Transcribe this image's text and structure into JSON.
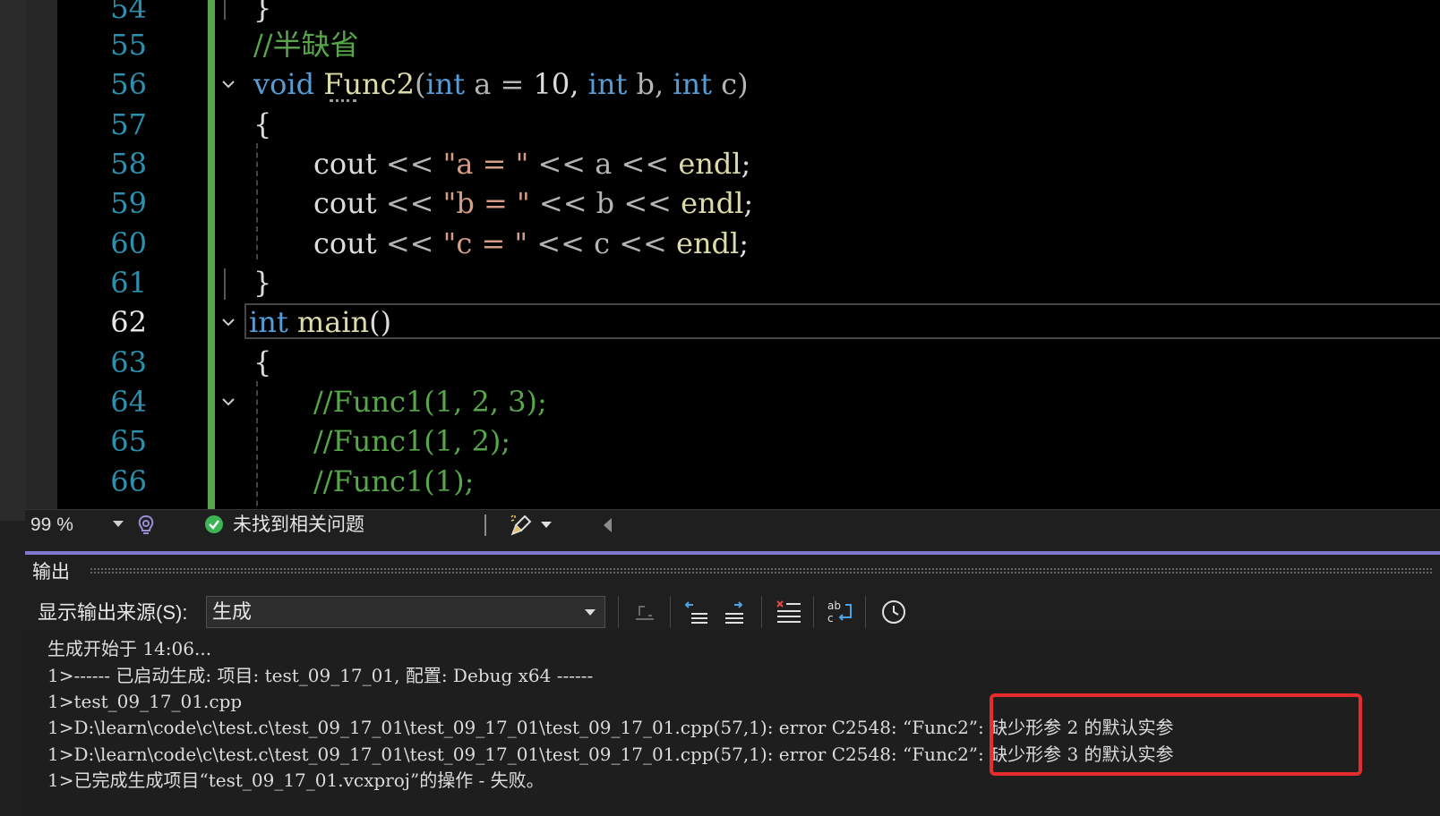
{
  "editor": {
    "lines": [
      {
        "num": "54"
      },
      {
        "num": "55"
      },
      {
        "num": "56"
      },
      {
        "num": "57"
      },
      {
        "num": "58"
      },
      {
        "num": "59"
      },
      {
        "num": "60"
      },
      {
        "num": "61"
      },
      {
        "num": "62"
      },
      {
        "num": "63"
      },
      {
        "num": "64"
      },
      {
        "num": "65"
      },
      {
        "num": "66"
      }
    ],
    "code": {
      "l54": "}",
      "l55": "//半缺省",
      "l56_kw": "void",
      "l56_fn": "Func2",
      "l56_p1": "(",
      "l56_int1": "int",
      "l56_a": "a",
      "l56_eq": "=",
      "l56_10": "10,",
      "l56_int2": "int",
      "l56_b": "b,",
      "l56_int3": "int",
      "l56_c": "c)",
      "l57": "{",
      "cout": "cout",
      "shl": "<<",
      "endl": "endl",
      "semi": ";",
      "l58_str": "\"a = \"",
      "l58_var": "a",
      "l59_str": "\"b = \"",
      "l59_var": "b",
      "l60_str": "\"c = \"",
      "l60_var": "c",
      "l61": "}",
      "l62_kw": "int",
      "l62_fn": "main",
      "l62_paren": "()",
      "l63": "{",
      "l64": "//Func1(1, 2, 3);",
      "l65": "//Func1(1, 2);",
      "l66": "//Func1(1);"
    },
    "status": {
      "zoom": "99 %",
      "issues": "未找到相关问题"
    }
  },
  "output": {
    "title": "输出",
    "source_label": "显示输出来源(S):",
    "source_value": "生成",
    "lines": [
      "生成开始于 14:06...",
      "1>------ 已启动生成: 项目: test_09_17_01, 配置: Debug x64 ------",
      "1>test_09_17_01.cpp",
      "1>D:\\learn\\code\\c\\test.c\\test_09_17_01\\test_09_17_01\\test_09_17_01.cpp(57,1): error C2548: “Func2”: 缺少形参 2 的默认实参",
      "1>D:\\learn\\code\\c\\test.c\\test_09_17_01\\test_09_17_01\\test_09_17_01.cpp(57,1): error C2548: “Func2”: 缺少形参 3 的默认实参",
      "1>已完成生成项目“test_09_17_01.vcxproj”的操作 - 失败。"
    ]
  },
  "colors": {
    "accent": "#8177ce",
    "change_bar": "#57a64a",
    "highlight": "#e52d2d",
    "keyword": "#569cd6",
    "comment": "#57a64a",
    "string": "#d69d85"
  }
}
